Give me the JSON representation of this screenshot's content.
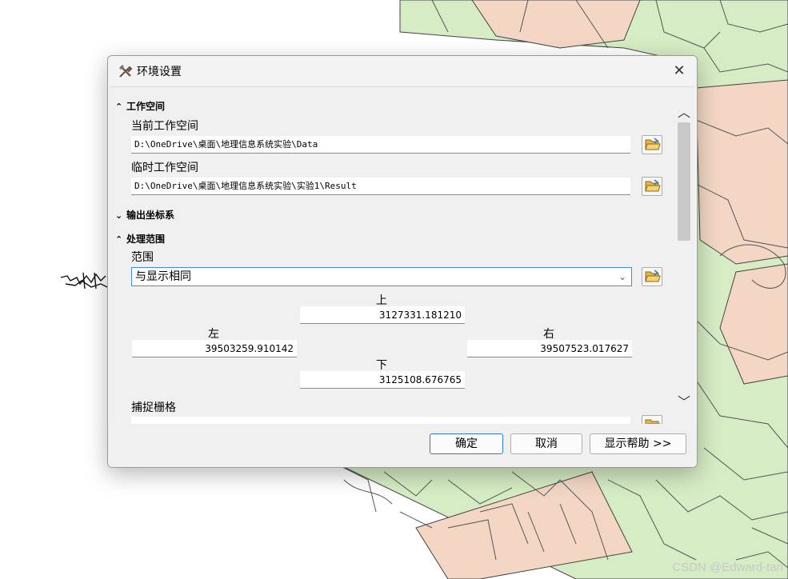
{
  "dialog": {
    "title": "环境设置",
    "close_symbol": "✕"
  },
  "sections": {
    "workspace": {
      "chevron": "≈",
      "title": "工作空间",
      "expanded": true
    },
    "output_coords": {
      "chevron": "≈",
      "title": "输出坐标系",
      "expanded": false
    },
    "processing_extent": {
      "chevron": "≈",
      "title": "处理范围",
      "expanded": true
    }
  },
  "workspace": {
    "current_label": "当前工作空间",
    "current_value": "D:\\OneDrive\\桌面\\地理信息系统实验\\Data",
    "scratch_label": "临时工作空间",
    "scratch_value": "D:\\OneDrive\\桌面\\地理信息系统实验\\实验1\\Result"
  },
  "extent": {
    "label": "范围",
    "selected": "与显示相同",
    "top_label": "上",
    "top_value": "3127331.181210",
    "left_label": "左",
    "left_value": "39503259.910142",
    "right_label": "右",
    "right_value": "39507523.017627",
    "bottom_label": "下",
    "bottom_value": "3125108.676765"
  },
  "snap_raster": {
    "label": "捕捉栅格"
  },
  "buttons": {
    "ok": "确定",
    "cancel": "取消",
    "help": "显示帮助 >>"
  },
  "watermark": "CSDN @Edward-tan",
  "colors": {
    "map_green": "#d6ecc4",
    "map_peach": "#f3d7c4",
    "accent_blue": "#2f7ad1"
  },
  "icons": {
    "title": "tools-icon",
    "folder": "folder-open-icon",
    "close": "close-icon"
  }
}
